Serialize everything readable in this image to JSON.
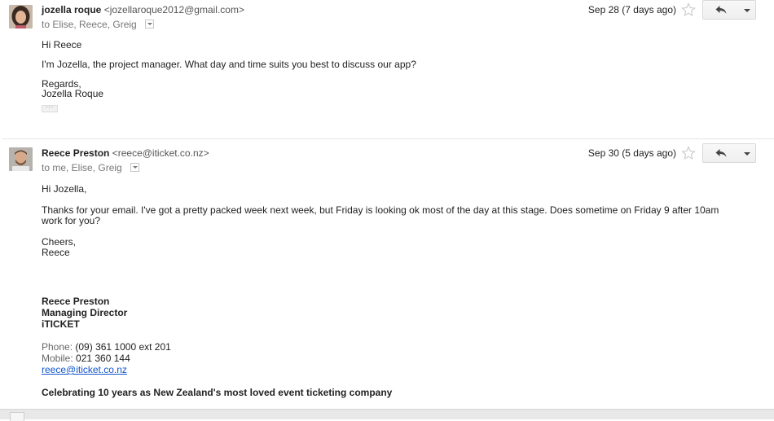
{
  "messages": [
    {
      "sender_name": "jozella roque",
      "sender_email": "<jozellaroque2012@gmail.com>",
      "recipients": "to Elise, Reece, Greig",
      "date": "Sep 28 (7 days ago)",
      "body": {
        "greeting": "Hi Reece",
        "para1": "I'm Jozella, the project manager. What day and time suits you best to discuss our app?",
        "signoff1": "Regards,",
        "signoff2": "Jozella Roque"
      }
    },
    {
      "sender_name": "Reece Preston",
      "sender_email": "<reece@iticket.co.nz>",
      "recipients": "to me, Elise, Greig",
      "date": "Sep 30 (5 days ago)",
      "body": {
        "greeting": "Hi Jozella,",
        "para1_line1": "Thanks for your email.  I've got a pretty packed week next week, but Friday is looking ok most of the day at this stage.  Does sometime on Friday 9 after 10am",
        "para1_line2": "work for you?",
        "signoff1": "Cheers,",
        "signoff2": "Reece"
      },
      "signature": {
        "name": "Reece Preston",
        "title": "Managing Director",
        "company": "iTICKET",
        "phone_label": "Phone:",
        "phone": "(09) 361 1000 ext 201",
        "mobile_label": "Mobile:",
        "mobile": "021 360 144",
        "email": "reece@iticket.co.nz",
        "tagline": "Celebrating 10 years as New Zealand's most loved event ticketing company"
      }
    }
  ],
  "icons": {
    "star": "star-icon",
    "reply": "reply-icon",
    "more": "chevron-down-icon",
    "recipient_details": "chevron-down-icon"
  },
  "colors": {
    "link": "#1155cc",
    "secondary_text": "#777777",
    "divider": "#e5e5e5"
  }
}
